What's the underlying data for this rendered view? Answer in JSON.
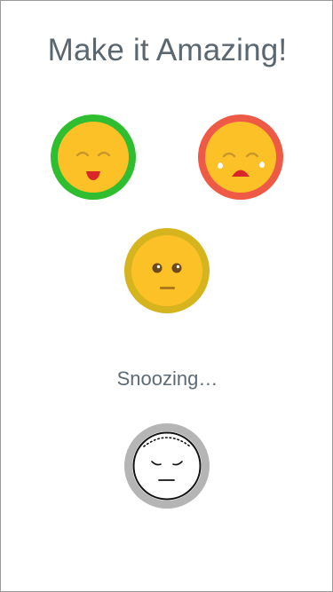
{
  "header": {
    "title": "Make it Amazing!"
  },
  "moods": [
    {
      "name": "happy",
      "icon": "happy-face-icon",
      "ring_color": "#2fbe2f",
      "face_color": "#fdc128"
    },
    {
      "name": "sad",
      "icon": "crying-face-icon",
      "ring_color": "#ee5a45",
      "face_color": "#fdc128"
    },
    {
      "name": "neutral",
      "icon": "neutral-face-icon",
      "ring_color": "#d5b41e",
      "face_color": "#fdc128"
    }
  ],
  "status": {
    "label": "Snoozing…",
    "icon": "sleeping-face-icon",
    "ring_color": "#b5b5b5",
    "face_color": "#ffffff"
  }
}
